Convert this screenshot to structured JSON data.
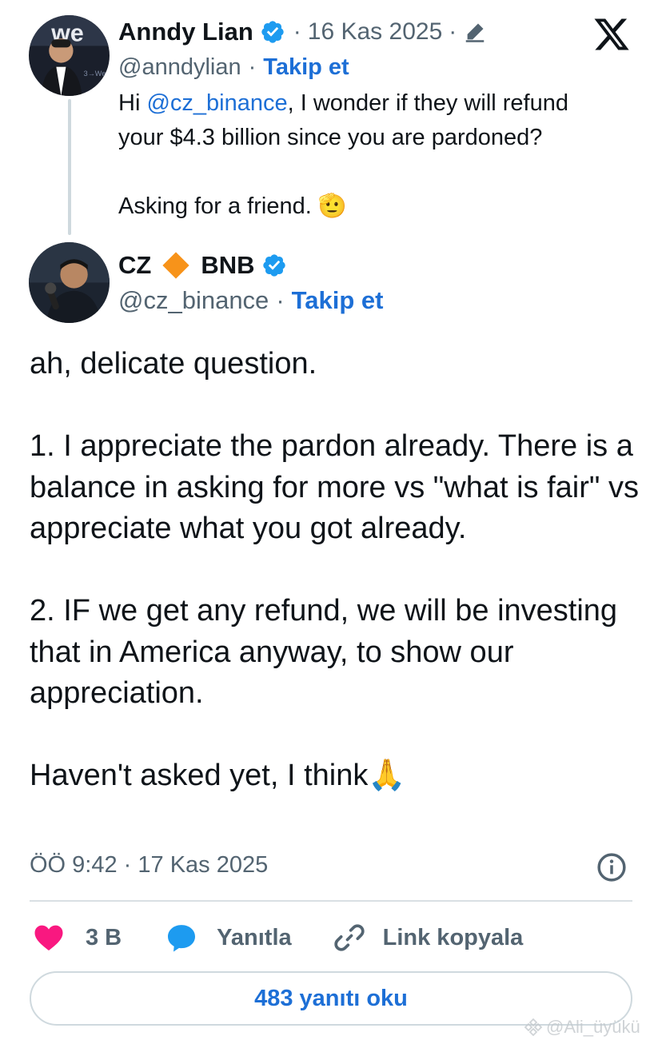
{
  "brand": {
    "logo": "x-logo-icon"
  },
  "quoted_tweet": {
    "author_name": "Anndy Lian",
    "date_sep": "·",
    "date": "16 Kas 2025",
    "trailing_sep": "·",
    "edit_icon": "pencil-icon",
    "handle": "@anndylian",
    "handle_sep": "·",
    "follow_label": "Takip et",
    "text_prefix": "Hi ",
    "mention": "@cz_binance",
    "text_line1_rest": ", I wonder if they will refund",
    "text_line2": "your $4.3 billion since you are pardoned?",
    "text_line3": "Asking for a friend. 🫡"
  },
  "main_tweet": {
    "author_name": "CZ",
    "author_emoji": "🔶",
    "author_suffix": "BNB",
    "handle": "@cz_binance",
    "handle_sep": "·",
    "follow_label": "Takip et",
    "paragraphs": [
      "ah, delicate question.",
      "1. I appreciate the pardon already. There is a balance in asking for more vs \"what is fair\" vs appreciate what you got already.",
      "2. IF we get any refund, we will be investing that in America anyway, to show our appreciation.",
      "Haven't asked yet, I think🙏"
    ],
    "timestamp": "ÖÖ 9:42 · 17 Kas 2025"
  },
  "actions": {
    "like_count": "3 B",
    "reply_label": "Yanıtla",
    "copy_link_label": "Link kopyala"
  },
  "replies_button": "483 yanıtı oku",
  "watermark": "@Ali_üyükü",
  "colors": {
    "link_blue": "#1d6fd6",
    "verified_blue": "#1d9bf0",
    "heart_pink": "#f91880",
    "muted_gray": "#536471",
    "bnb_orange": "#f3ba2f"
  }
}
